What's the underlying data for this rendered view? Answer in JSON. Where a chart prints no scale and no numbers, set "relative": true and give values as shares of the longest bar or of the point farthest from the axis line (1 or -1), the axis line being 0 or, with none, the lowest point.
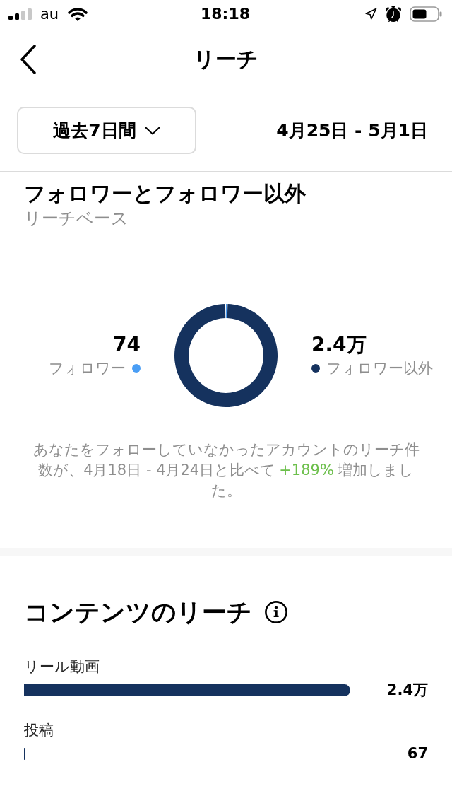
{
  "status_bar": {
    "carrier": "au",
    "time": "18:18"
  },
  "header": {
    "title": "リーチ"
  },
  "period": {
    "label": "過去7日間",
    "range": "4月25日 - 5月1日"
  },
  "audience": {
    "title": "フォロワーとフォロワー以外",
    "subtitle": "リーチベース",
    "legend": [
      {
        "value": "74",
        "color": "#4a9ef5"
      },
      {
        "value": "2.4万",
        "color": "#15325e"
      }
    ],
    "chart_data": {
      "type": "donut",
      "categories": [
        "フォロワー",
        "フォロワー以外"
      ],
      "values": [
        0.3,
        99.7
      ]
    },
    "note": {
      "before": "あなたをフォローしていなかったアカウントのリーチ件数が、4月18日 - 4月24日と比べて",
      "change": "+189%",
      "after": "増加しました。"
    }
  },
  "content_reach": {
    "title": "コンテンツのリーチ",
    "counts": [
      "2.4万",
      "67"
    ],
    "chart_data": {
      "type": "bar",
      "orientation": "horizontal",
      "relative": true,
      "categories": [
        "リール動画",
        "投稿"
      ],
      "values": [
        1,
        0.0028
      ]
    }
  }
}
